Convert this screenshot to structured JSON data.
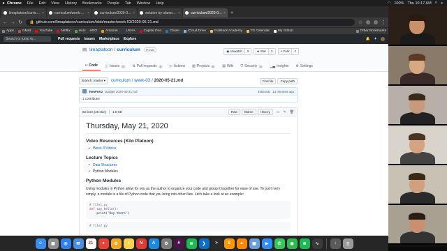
{
  "menubar": {
    "app": "Chrome",
    "items": [
      "File",
      "Edit",
      "View",
      "History",
      "Bookmarks",
      "People",
      "Tab",
      "Window",
      "Help"
    ],
    "battery": "100%",
    "clock": "Thu 10:17 AM"
  },
  "tabs": [
    {
      "label": "limaplatoon/curriculum",
      "active": false
    },
    {
      "label": "curriculum/week-03 at master",
      "active": false
    },
    {
      "label": "curriculum/2020-05-20.md at",
      "active": false
    },
    {
      "label": "solution by olamowski2 · Pull",
      "active": false
    },
    {
      "label": "curriculum/2020-05-21.md at",
      "active": true
    }
  ],
  "url": "github.com/limaplatoon/curriculum/blob/master/week-03/2020-05-21.md",
  "bookmarks": [
    "Apps",
    "GMail",
    "YouTube",
    "Netflix",
    "Hulu",
    "HBO",
    "Amazon",
    "USAA",
    "Capital One",
    "Chase",
    "iCloud Drive",
    "Fullstack Academy",
    "FS Calendar",
    "My Github"
  ],
  "bookmarks_other": "Other Bookmarks",
  "github_nav": {
    "search_placeholder": "Search or jump to...",
    "links": [
      "Pull requests",
      "Issues",
      "Marketplace",
      "Explore"
    ]
  },
  "repo": {
    "owner": "limaplatoon",
    "name": "curriculum",
    "visibility": "Private",
    "unwatch": "Unwatch",
    "unwatch_count": "5",
    "star": "Star",
    "star_count": "2",
    "fork": "Fork",
    "fork_count": "2",
    "tabs": [
      {
        "label": "Code",
        "count": ""
      },
      {
        "label": "Issues",
        "count": "0"
      },
      {
        "label": "Pull requests",
        "count": "0"
      },
      {
        "label": "Actions",
        "count": ""
      },
      {
        "label": "Projects",
        "count": "0"
      },
      {
        "label": "Wiki",
        "count": ""
      },
      {
        "label": "Security",
        "count": "0"
      },
      {
        "label": "Insights",
        "count": ""
      },
      {
        "label": "Settings",
        "count": ""
      }
    ]
  },
  "file_nav": {
    "branch": "Branch: master",
    "path": [
      "curriculum",
      "week-03"
    ],
    "file": "2020-05-21.md",
    "find_file": "Find file",
    "copy_path": "Copy path"
  },
  "commit": {
    "user": "TomFrerz",
    "message": "Update 2020-05-21.md",
    "sha": "4455166",
    "time": "13 minutes ago",
    "contributors": "1 contributor"
  },
  "file_header": {
    "lines": "92 lines (26 sloc)",
    "size": "1.5 KB",
    "raw": "Raw",
    "blame": "Blame",
    "history": "History"
  },
  "doc": {
    "title": "Thursday, May 21, 2020",
    "section1": "Video Resources (Kilo Platoon)",
    "section1_items": [
      "Week 3 Videos"
    ],
    "section2": "Lecture Topics",
    "section2_items": [
      "Data Structures",
      "Python Modules"
    ],
    "section3": "Python Modules",
    "paragraph": "Using modules in Python allow for you as the author to organize your code and group it together for ease of use. To put it very simply, a module is a file of Python code that you bring into other files. Let's take a look at an example:",
    "code1_comment": "# file1.py",
    "code1_def": "def",
    "code1_func": "say_hello():",
    "code1_print": "print(",
    "code1_str": "'Hey there'",
    "code1_close": ")",
    "code2_comment": "# file2.py"
  },
  "dock_icons": [
    {
      "name": "finder",
      "color": "#3b8ef0",
      "glyph": "☺"
    },
    {
      "name": "launchpad",
      "color": "#8e8e93",
      "glyph": "▦"
    },
    {
      "name": "safari",
      "color": "#2f80ed",
      "glyph": "◎"
    },
    {
      "name": "mail",
      "color": "#4a90e2",
      "glyph": "✉"
    },
    {
      "name": "calendar",
      "color": "#ffffff",
      "glyph": "21"
    },
    {
      "name": "chrome",
      "color": "#e94235",
      "glyph": "●"
    },
    {
      "name": "photos",
      "color": "#f5a623",
      "glyph": "✿"
    },
    {
      "name": "notes",
      "color": "#f8d34a",
      "glyph": "≡"
    },
    {
      "name": "news",
      "color": "#e53935",
      "glyph": "N"
    },
    {
      "name": "app-store",
      "color": "#1e88e5",
      "glyph": "A"
    },
    {
      "name": "system-preferences",
      "color": "#7d7d7d",
      "glyph": "⚙"
    },
    {
      "name": "slack",
      "color": "#4a154b",
      "glyph": "#"
    },
    {
      "name": "spotify",
      "color": "#1db954",
      "glyph": "≋"
    },
    {
      "name": "vscode",
      "color": "#0a6fc2",
      "glyph": "❯"
    },
    {
      "name": "terminal",
      "color": "#2b2b2b",
      "glyph": ">"
    },
    {
      "name": "sublime",
      "color": "#ff9800",
      "glyph": "S"
    },
    {
      "name": "vlc",
      "color": "#ff8800",
      "glyph": "▲"
    },
    {
      "name": "preview",
      "color": "#6d9fd6",
      "glyph": "▣"
    },
    {
      "name": "zoom",
      "color": "#2d8cff",
      "glyph": "▶"
    },
    {
      "name": "messages",
      "color": "#34c759",
      "glyph": "✆"
    },
    {
      "name": "facetime",
      "color": "#30b94d",
      "glyph": "◉"
    },
    {
      "name": "spotify-2",
      "color": "#1db954",
      "glyph": "≋"
    },
    {
      "name": "activity-monitor",
      "color": "#3a3a3a",
      "glyph": "∿"
    },
    {
      "name": "downloads",
      "color": "#5b5b5b",
      "glyph": "↓"
    },
    {
      "name": "trash",
      "color": "#9a9a9a",
      "glyph": "▯"
    }
  ],
  "participants": [
    {
      "bg": "#2a2018",
      "skin": "#c9906a",
      "hair": "#2a1a10",
      "shirt": "#1a1a1a"
    },
    {
      "bg": "#8a7a6a",
      "skin": "#d8a882",
      "hair": "#5a3a22",
      "shirt": "#3a2a2a"
    },
    {
      "bg": "#b8b0a8",
      "skin": "#c69a7a",
      "hair": "#3a2a1a",
      "shirt": "#222222"
    },
    {
      "bg": "#d8d4cc",
      "skin": "#d4a482",
      "hair": "#4a3424",
      "shirt": "#444444"
    },
    {
      "bg": "#c8c2b4",
      "skin": "#d0a080",
      "hair": "#3a2818",
      "shirt": "#2a2a2a"
    },
    {
      "bg": "#a8a090",
      "skin": "#c89070",
      "hair": "#2a1e14",
      "shirt": "#333333"
    }
  ]
}
